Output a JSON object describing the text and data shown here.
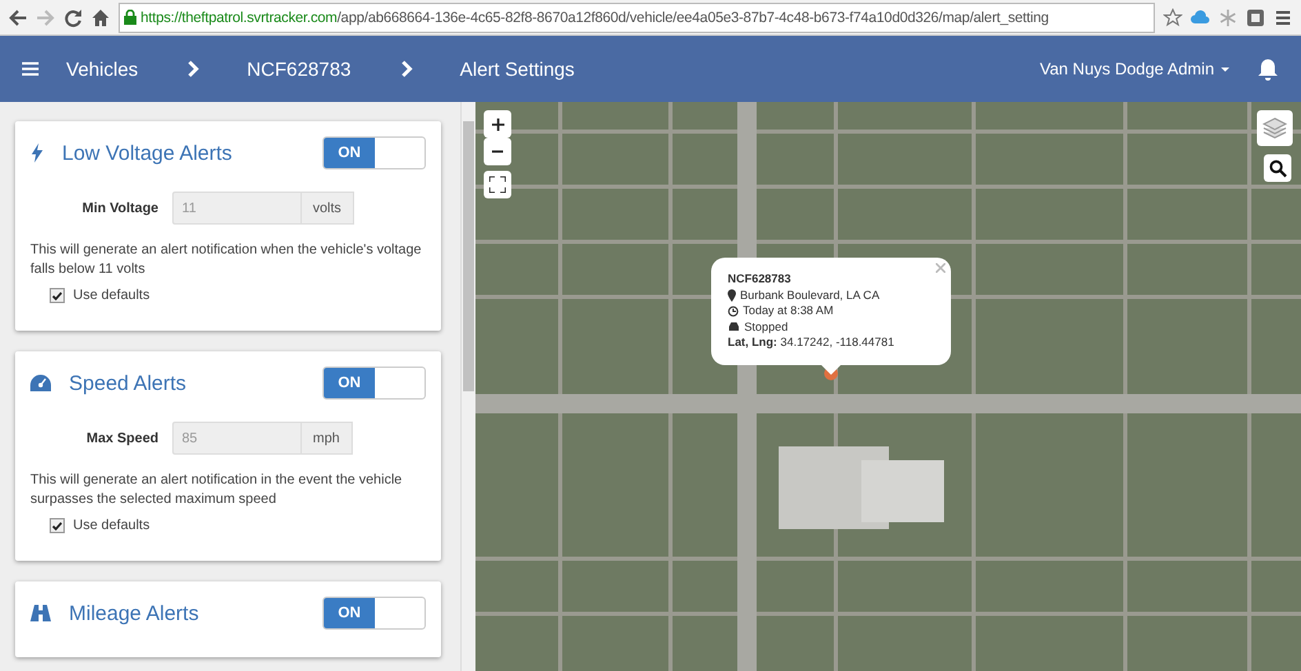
{
  "browser": {
    "url_host": "https://theftpatrol.svrtracker.com",
    "url_path": "/app/ab668664-136e-4c65-82f8-8670a12f860d/vehicle/ee4a05e3-87b7-4c48-b673-f74a10d0d326/map/alert_setting"
  },
  "navbar": {
    "breadcrumbs": [
      "Vehicles",
      "NCF628783",
      "Alert Settings"
    ],
    "user": "Van Nuys Dodge Admin"
  },
  "alerts": [
    {
      "kind": "voltage",
      "title": "Low Voltage Alerts",
      "toggle": {
        "label": "ON",
        "on": true
      },
      "field_label": "Min Voltage",
      "value": "11",
      "unit": "volts",
      "description": "This will generate an alert notification when the vehicle's voltage falls below 11 volts",
      "defaults": {
        "label": "Use defaults",
        "checked": true
      }
    },
    {
      "kind": "speed",
      "title": "Speed Alerts",
      "toggle": {
        "label": "ON",
        "on": true
      },
      "field_label": "Max Speed",
      "value": "85",
      "unit": "mph",
      "description": "This will generate an alert notification in the event the vehicle surpasses the selected maximum speed",
      "defaults": {
        "label": "Use defaults",
        "checked": true
      }
    },
    {
      "kind": "mileage",
      "title": "Mileage Alerts",
      "toggle": {
        "label": "ON",
        "on": true
      }
    }
  ],
  "map": {
    "popup": {
      "vehicle": "NCF628783",
      "address": "Burbank Boulevard, LA CA",
      "time": "Today at 8:38 AM",
      "status": "Stopped",
      "coords_label": "Lat, Lng:",
      "coords": "34.17242, -118.44781"
    }
  }
}
